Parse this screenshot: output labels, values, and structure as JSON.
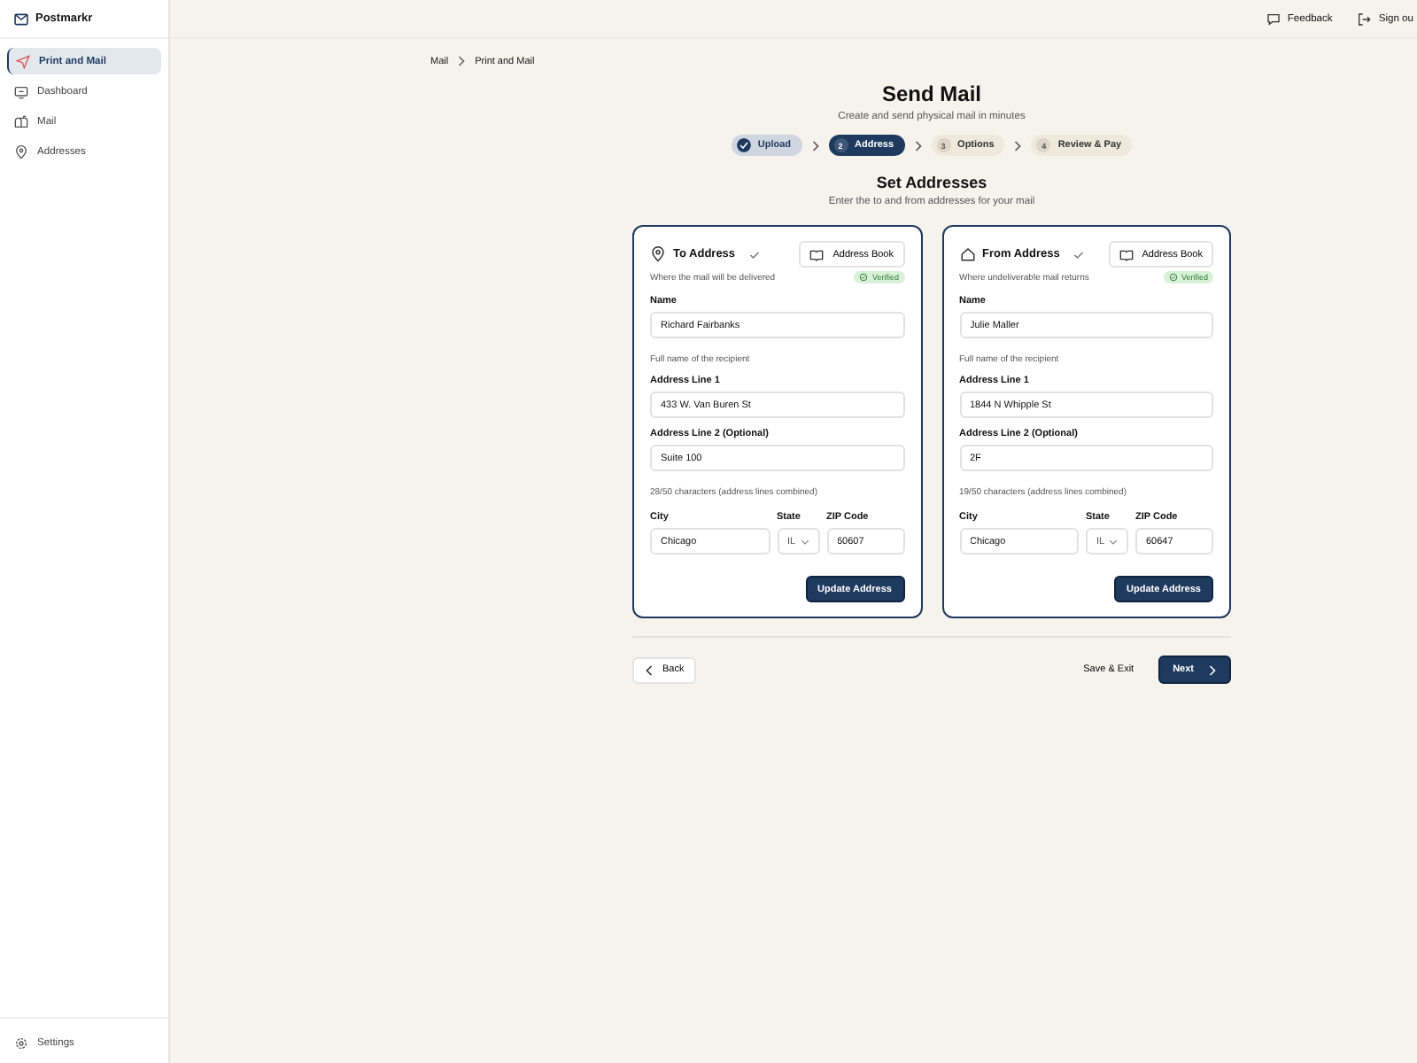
{
  "sidebar": {
    "brand": "Postmarkr",
    "items": [
      {
        "label": "Print and Mail",
        "selected": true
      },
      {
        "label": "Dashboard",
        "selected": false
      },
      {
        "label": "Mail",
        "selected": false
      },
      {
        "label": "Addresses",
        "selected": false
      }
    ],
    "footer": {
      "label": "Settings"
    }
  },
  "header": {
    "actions": [
      {
        "label": "Feedback"
      },
      {
        "label": "Sign ou"
      }
    ]
  },
  "breadcrumb": [
    "Mail",
    "Print and Mail"
  ],
  "title": "Send Mail",
  "subtitle": "Create and send physical mail in minutes",
  "steps": [
    {
      "label": "Upload",
      "completed": true,
      "selected": false
    },
    {
      "number": "2",
      "label": "Address",
      "completed": false,
      "selected": true
    },
    {
      "number": "3",
      "label": "Options",
      "completed": false,
      "selected": false
    },
    {
      "number": "4",
      "label": "Review & Pay",
      "completed": false,
      "selected": false
    }
  ],
  "section": {
    "title": "Set Addresses",
    "subtitle": "Enter the to and from addresses for your mail"
  },
  "cards": [
    {
      "title": "To Address",
      "checked": true,
      "book": "Address Book",
      "description": "Where the mail will be delivered",
      "verified": true,
      "badge": "Verified",
      "fields": {
        "name": {
          "label": "Name",
          "value": "Richard Fairbanks",
          "hint": "Full name of the recipient"
        },
        "line1": {
          "label": "Address Line 1",
          "value": "433 W. Van Buren St"
        },
        "line2": {
          "label": "Address Line 2 (Optional)",
          "value": "Suite 100",
          "hint": "28/50 characters (address lines combined)"
        },
        "city": {
          "label": "City",
          "value": "Chicago"
        },
        "state": {
          "label": "State",
          "value": "IL"
        },
        "zip": {
          "label": "ZIP Code",
          "value": "60607"
        }
      },
      "button": "Update Address"
    },
    {
      "title": "From Address",
      "checked": true,
      "book": "Address Book",
      "description": "Where undeliverable mail returns",
      "verified": true,
      "badge": "Verified",
      "fields": {
        "name": {
          "label": "Name",
          "value": "Julie Maller",
          "hint": "Full name of the recipient"
        },
        "line1": {
          "label": "Address Line 1",
          "value": "1844 N Whipple St"
        },
        "line2": {
          "label": "Address Line 2 (Optional)",
          "value": "2F",
          "hint": "19/50 characters (address lines combined)"
        },
        "city": {
          "label": "City",
          "value": "Chicago"
        },
        "state": {
          "label": "State",
          "value": "IL"
        },
        "zip": {
          "label": "ZIP Code",
          "value": "60647"
        }
      },
      "button": "Update Address"
    }
  ],
  "footer": {
    "back": "Back",
    "save": "Save & Exit",
    "next": "Next"
  }
}
